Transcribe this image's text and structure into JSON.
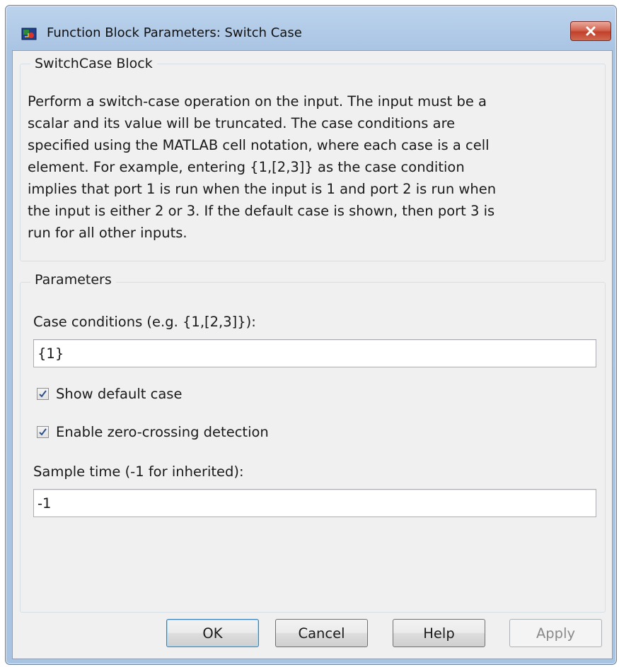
{
  "window": {
    "title": "Function Block Parameters: Switch Case",
    "icon": "simulink-block-icon"
  },
  "block_group": {
    "legend": "SwitchCase Block",
    "description_lines": [
      "Perform a switch-case operation on the input.  The input must be a",
      "scalar and its value will be truncated.  The case conditions are",
      "specified using the MATLAB cell notation, where each case is a cell",
      "element.  For example, entering {1,[2,3]} as the case condition",
      "implies that port 1 is run when the input is 1 and port 2 is run when",
      "the input is either 2 or 3.  If the default case is shown, then port 3 is",
      "run for all other inputs."
    ]
  },
  "parameters": {
    "legend": "Parameters",
    "case_conditions": {
      "label": "Case conditions (e.g. {1,[2,3]}):",
      "value": "{1}"
    },
    "show_default_case": {
      "label": "Show default case",
      "checked": true
    },
    "zero_crossing": {
      "label": "Enable zero-crossing detection",
      "checked": true
    },
    "sample_time": {
      "label": "Sample time (-1 for inherited):",
      "value": "-1"
    }
  },
  "buttons": {
    "ok": "OK",
    "cancel": "Cancel",
    "help": "Help",
    "apply": "Apply"
  }
}
